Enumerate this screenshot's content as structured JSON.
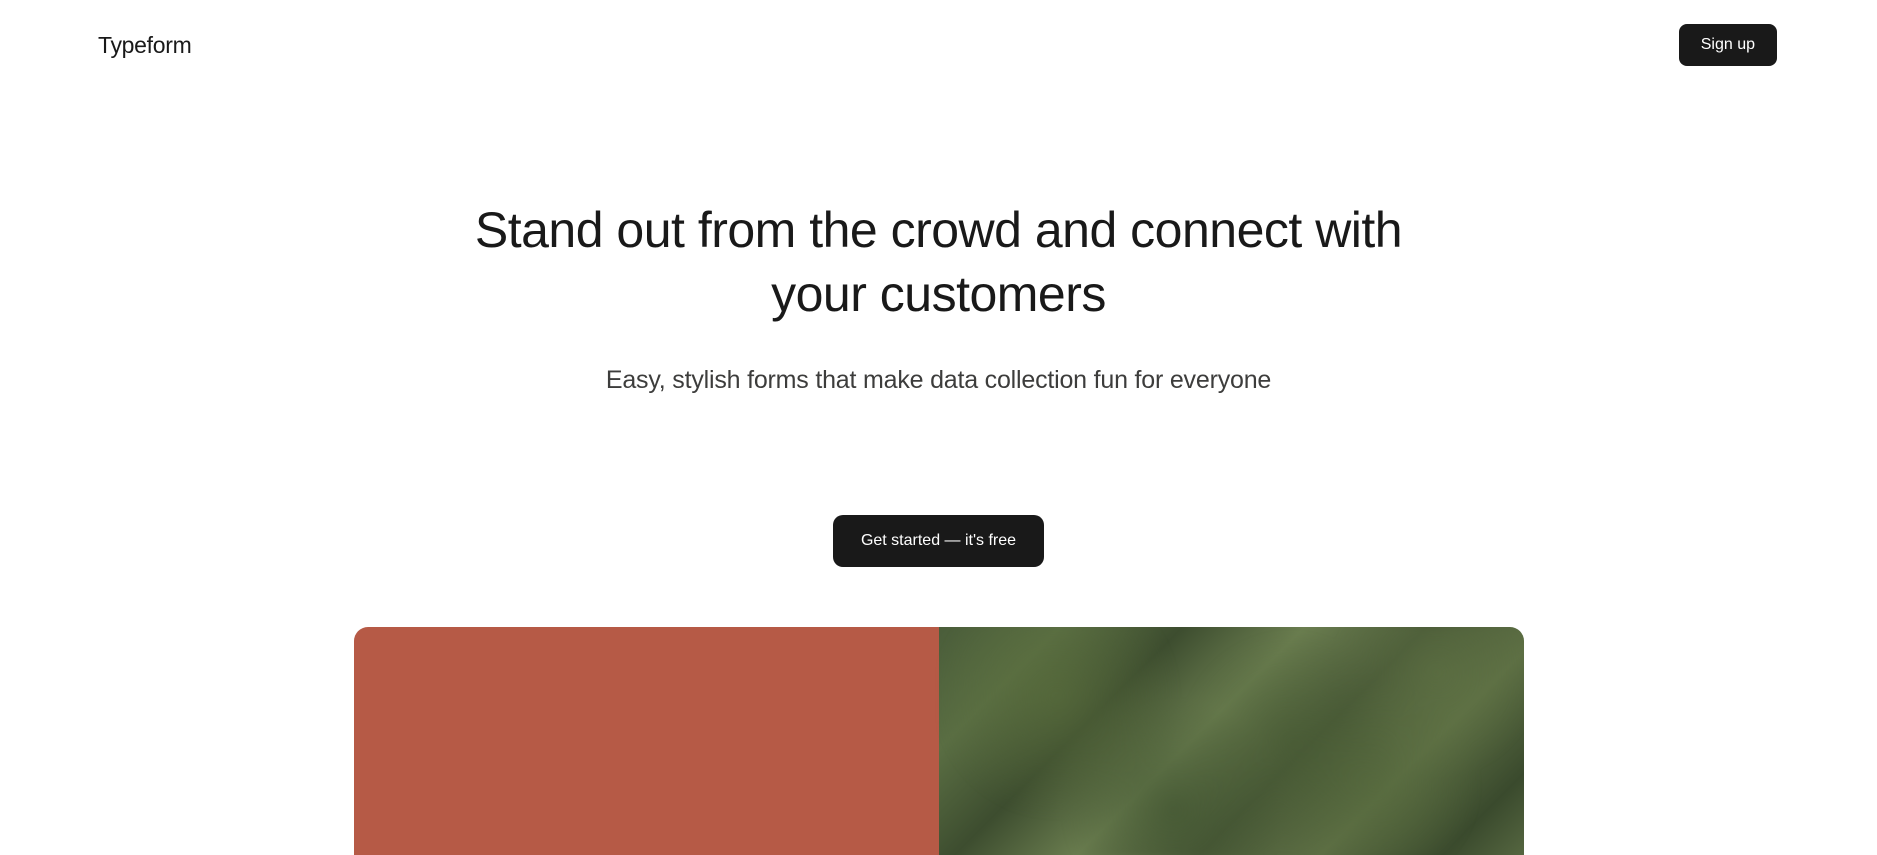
{
  "header": {
    "logo": "Typeform",
    "signup_label": "Sign up"
  },
  "hero": {
    "title": "Stand out from the crowd and connect with your customers",
    "subtitle": "Easy, stylish forms that make data collection fun for everyone",
    "cta_label": "Get started — it's free"
  }
}
